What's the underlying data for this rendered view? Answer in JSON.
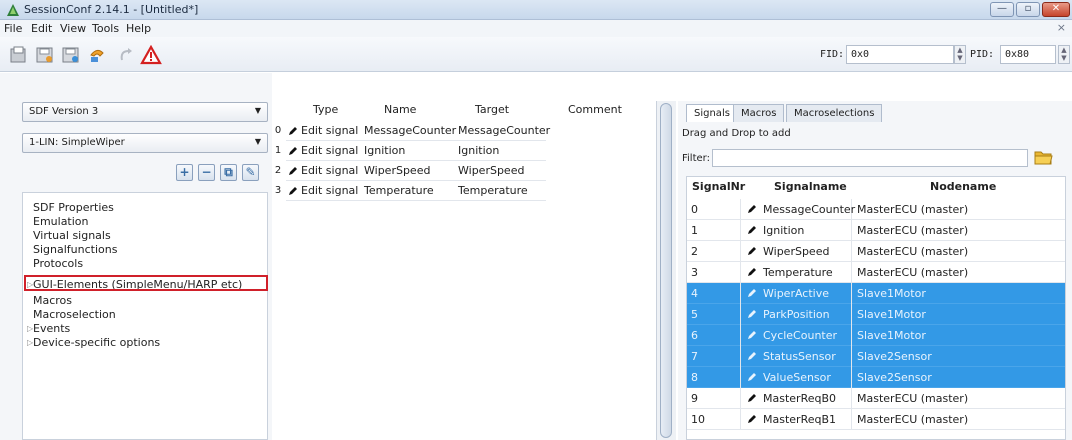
{
  "window": {
    "title": "SessionConf 2.14.1 - [Untitled*]",
    "minimize": "—",
    "maximize": "▫",
    "close": "✕"
  },
  "menu": {
    "items": [
      "File",
      "Edit",
      "View",
      "Tools",
      "Help"
    ],
    "close": "×"
  },
  "toolbar": {
    "icons": [
      "open-icon",
      "save-icon",
      "save-as-icon",
      "undo-icon",
      "redo-icon",
      "warning-icon"
    ],
    "fid_label": "FID:",
    "fid_value": "0x0",
    "pid_label": "PID:",
    "pid_value": "0x80"
  },
  "left": {
    "sdf_version": "SDF Version 3",
    "node_select": "1-LIN: SimpleWiper",
    "tree": [
      {
        "label": "SDF Properties",
        "expander": ""
      },
      {
        "label": "Emulation",
        "expander": ""
      },
      {
        "label": "Virtual signals",
        "expander": ""
      },
      {
        "label": "Signalfunctions",
        "expander": ""
      },
      {
        "label": "Protocols",
        "expander": ""
      },
      {
        "label": "GUI-Elements (SimpleMenu/HARP etc)",
        "expander": "▷"
      },
      {
        "label": "Macros",
        "expander": ""
      },
      {
        "label": "Macroselection",
        "expander": ""
      },
      {
        "label": "Events",
        "expander": "▷"
      },
      {
        "label": "Device-specific options",
        "expander": "▷"
      }
    ]
  },
  "middle": {
    "columns": [
      "Type",
      "Name",
      "Target",
      "Comment"
    ],
    "rows": [
      {
        "n": "0",
        "type": "Edit signal",
        "name": "MessageCounter",
        "target": "MessageCounter"
      },
      {
        "n": "1",
        "type": "Edit signal",
        "name": "Ignition",
        "target": "Ignition"
      },
      {
        "n": "2",
        "type": "Edit signal",
        "name": "WiperSpeed",
        "target": "WiperSpeed"
      },
      {
        "n": "3",
        "type": "Edit signal",
        "name": "Temperature",
        "target": "Temperature"
      }
    ]
  },
  "right": {
    "tabs": [
      "Signals",
      "Macros",
      "Macroselections"
    ],
    "hint": "Drag and Drop to add",
    "filter_label": "Filter:",
    "columns": [
      "SignalNr",
      "Signalname",
      "Nodename"
    ],
    "rows": [
      {
        "nr": "0",
        "name": "MessageCounter",
        "node": "MasterECU (master)",
        "selected": false
      },
      {
        "nr": "1",
        "name": "Ignition",
        "node": "MasterECU (master)",
        "selected": false
      },
      {
        "nr": "2",
        "name": "WiperSpeed",
        "node": "MasterECU (master)",
        "selected": false
      },
      {
        "nr": "3",
        "name": "Temperature",
        "node": "MasterECU (master)",
        "selected": false
      },
      {
        "nr": "4",
        "name": "WiperActive",
        "node": "Slave1Motor",
        "selected": true
      },
      {
        "nr": "5",
        "name": "ParkPosition",
        "node": "Slave1Motor",
        "selected": true
      },
      {
        "nr": "6",
        "name": "CycleCounter",
        "node": "Slave1Motor",
        "selected": true
      },
      {
        "nr": "7",
        "name": "StatusSensor",
        "node": "Slave2Sensor",
        "selected": true
      },
      {
        "nr": "8",
        "name": "ValueSensor",
        "node": "Slave2Sensor",
        "selected": true
      },
      {
        "nr": "9",
        "name": "MasterReqB0",
        "node": "MasterECU (master)",
        "selected": false
      },
      {
        "nr": "10",
        "name": "MasterReqB1",
        "node": "MasterECU (master)",
        "selected": false
      }
    ]
  }
}
